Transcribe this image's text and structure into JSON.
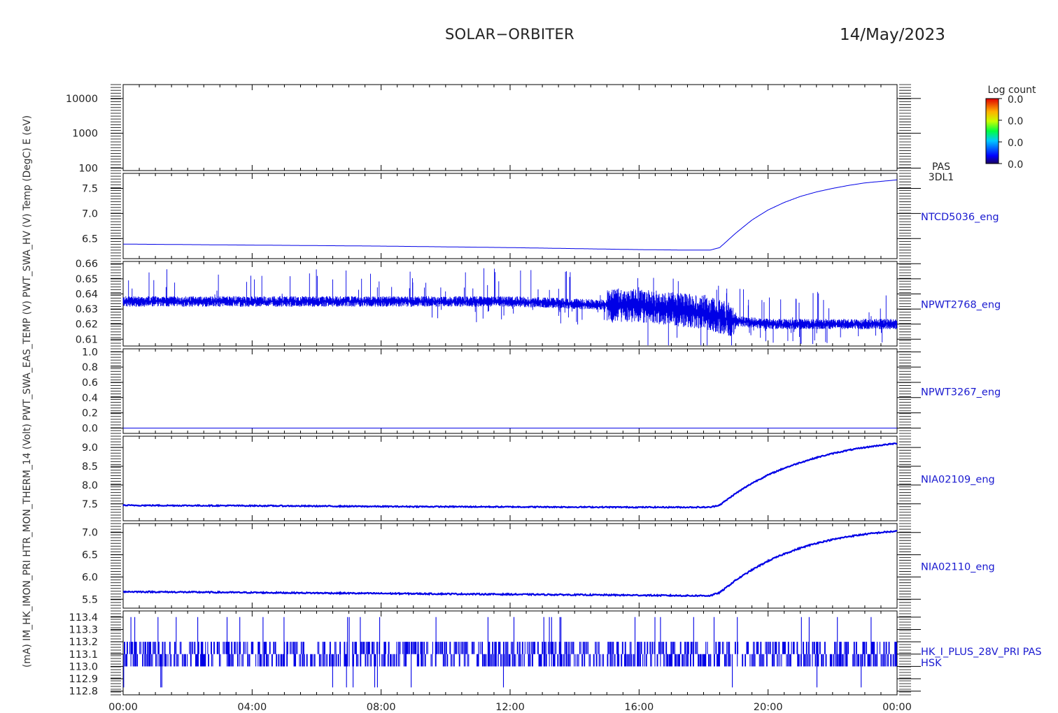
{
  "header": {
    "title": "SOLAR−ORBITER",
    "date": "14/May/2023"
  },
  "colors": {
    "data_line": "#0000e6",
    "axis": "#000000",
    "label_text": "#1a1ad0"
  },
  "colorbar": {
    "title": "Log count",
    "tick_labels": [
      "0.0",
      "0.0",
      "0.0",
      "0.0"
    ],
    "colormap": "rainbow"
  },
  "left_axis_label_overlap": "(mA)  IM_HK_IMON_PRI   HTR_MON_THERM_14 (Volt)   PWT_SWA_EAS_TEMP (V)   PWT_SWA_HV (V)   Temp (DegC)   E (eV)",
  "chart_data": [
    {
      "type": "heatmap",
      "panel_label": [
        "PAS",
        "3DL1"
      ],
      "ylabel": "E (eV)",
      "y_scale": "log",
      "yticks": [
        "10000",
        "1000",
        "100"
      ],
      "ytick_values": [
        10000,
        1000,
        100
      ],
      "ylim": [
        85,
        25000
      ],
      "values": []
    },
    {
      "type": "line",
      "panel_label": [
        "NTCD5036_eng"
      ],
      "yticks": [
        "7.5",
        "7.0",
        "6.5"
      ],
      "ylim": [
        6.1,
        7.8
      ],
      "x_hours": [
        0,
        4,
        8,
        12,
        16,
        17.5,
        18.2,
        18.5,
        19,
        19.5,
        20,
        20.5,
        21,
        21.5,
        22,
        22.5,
        23,
        23.5,
        24
      ],
      "y": [
        6.39,
        6.37,
        6.35,
        6.32,
        6.28,
        6.27,
        6.27,
        6.32,
        6.61,
        6.87,
        7.07,
        7.22,
        7.34,
        7.43,
        7.5,
        7.56,
        7.61,
        7.64,
        7.67
      ]
    },
    {
      "type": "line",
      "panel_label": [
        "NPWT2768_eng"
      ],
      "yticks": [
        "0.66",
        "0.65",
        "0.64",
        "0.63",
        "0.62",
        "0.61"
      ],
      "ylim": [
        0.6055,
        0.6615
      ],
      "x_hours": [
        0,
        8,
        12,
        16,
        18,
        19,
        20,
        24
      ],
      "y": [
        0.635,
        0.635,
        0.635,
        0.632,
        0.628,
        0.622,
        0.62,
        0.62
      ],
      "noise": "dense spikes"
    },
    {
      "type": "line",
      "panel_label": [
        "NPWT3267_eng"
      ],
      "yticks": [
        "1.0",
        "0.8",
        "0.6",
        "0.4",
        "0.2",
        "0.0"
      ],
      "ylim": [
        -0.07,
        1.04
      ],
      "x_hours": [
        0,
        24
      ],
      "y": [
        0.0,
        0.0
      ]
    },
    {
      "type": "line",
      "panel_label": [
        "NIA02109_eng"
      ],
      "yticks": [
        "9.0",
        "8.5",
        "8.0",
        "7.5"
      ],
      "ylim": [
        7.05,
        9.3
      ],
      "x_hours": [
        0,
        4,
        8,
        12,
        16,
        17.5,
        18.2,
        18.5,
        19,
        19.5,
        20,
        20.5,
        21,
        21.5,
        22,
        22.5,
        23,
        23.5,
        24
      ],
      "y": [
        7.46,
        7.45,
        7.43,
        7.42,
        7.41,
        7.41,
        7.41,
        7.47,
        7.78,
        8.05,
        8.27,
        8.45,
        8.6,
        8.73,
        8.84,
        8.93,
        9.0,
        9.06,
        9.11
      ]
    },
    {
      "type": "line",
      "panel_label": [
        "NIA02110_eng"
      ],
      "yticks": [
        "7.0",
        "6.5",
        "6.0",
        "5.5"
      ],
      "ylim": [
        5.3,
        7.2
      ],
      "x_hours": [
        0,
        4,
        8,
        12,
        16,
        17.5,
        18.2,
        18.5,
        19,
        19.5,
        20,
        20.5,
        21,
        21.5,
        22,
        22.5,
        23,
        23.5,
        24
      ],
      "y": [
        5.67,
        5.65,
        5.63,
        5.61,
        5.59,
        5.58,
        5.58,
        5.65,
        5.93,
        6.16,
        6.36,
        6.52,
        6.65,
        6.76,
        6.84,
        6.91,
        6.96,
        7.0,
        7.03
      ]
    },
    {
      "type": "line",
      "panel_label": [
        "HK_I_PLUS_28V_PRI PAS",
        "HSK"
      ],
      "yticks": [
        "113.4",
        "113.3",
        "113.2",
        "113.1",
        "113.0",
        "112.9",
        "112.8"
      ],
      "ylim": [
        112.77,
        113.45
      ],
      "levels": [
        113.0,
        113.1,
        113.2
      ],
      "noise": "quantized switching"
    }
  ],
  "x_axis": {
    "tick_labels": [
      "00:00",
      "04:00",
      "08:00",
      "12:00",
      "16:00",
      "20:00",
      "00:00"
    ],
    "range_hours": [
      0,
      24
    ]
  }
}
